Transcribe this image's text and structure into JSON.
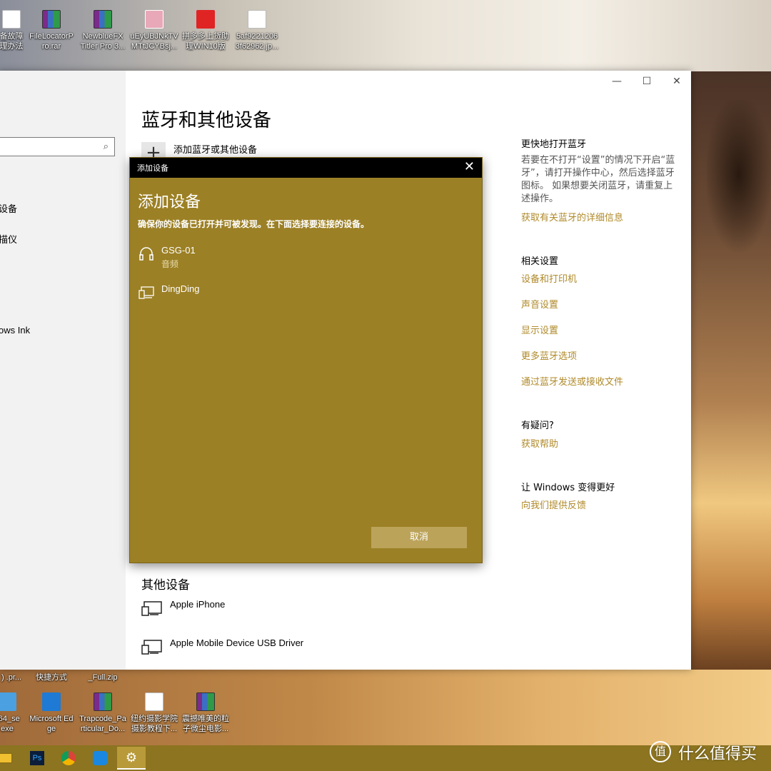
{
  "desktop": {
    "top_icons": [
      {
        "label_1": "备故障",
        "label_2": "理办法",
        "icon": "document-icon"
      },
      {
        "label_1": "FileLocatorP",
        "label_2": "ro.rar",
        "icon": "rar-archive-icon"
      },
      {
        "label_1": "NewblueFX",
        "label_2": "Titler Pro 3...",
        "icon": "rar-archive-icon"
      },
      {
        "label_1": "uEyUBJNkTV",
        "label_2": "MTtJCYBsj...",
        "icon": "image-icon"
      },
      {
        "label_1": "拼多多上货助",
        "label_2": "理WIN10版",
        "icon": "app-icon"
      },
      {
        "label_1": "5af9221206",
        "label_2": "3f62962.jp...",
        "icon": "document-icon"
      }
    ],
    "partial_labels": [
      {
        "label_1": ") .pr...",
        "label_2": ""
      },
      {
        "label_1": "快捷方式",
        "label_2": ""
      },
      {
        "label_1": "_Full.zip",
        "label_2": ""
      }
    ],
    "bottom_icons": [
      {
        "label_1": "x64_se",
        "label_2": "exe",
        "icon": "installer-icon"
      },
      {
        "label_1": "Microsoft Ed",
        "label_2": "ge",
        "icon": "edge-icon"
      },
      {
        "label_1": "Trapcode_Pa",
        "label_2": "rticular_Do...",
        "icon": "rar-archive-icon"
      },
      {
        "label_1": "纽约摄影学院",
        "label_2": "摄影教程下...",
        "icon": "document-icon"
      },
      {
        "label_1": "震撼唯美的粒",
        "label_2": "子微尘电影...",
        "icon": "rar-archive-icon"
      }
    ]
  },
  "settings": {
    "sidebar": {
      "items": [
        "设备",
        "描仪",
        "ows Ink"
      ]
    },
    "window_controls": {
      "minimize": "—",
      "maximize": "☐",
      "close": "✕"
    },
    "page_title": "蓝牙和其他设备",
    "add_device_label": "添加蓝牙或其他设备",
    "add_plus": "+",
    "right": {
      "quick_head": "更快地打开蓝牙",
      "quick_text": "若要在不打开“设置”的情况下开启“蓝牙”，请打开操作中心，然后选择蓝牙图标。 如果想要关闭蓝牙，请重复上述操作。",
      "quick_link": "获取有关蓝牙的详细信息",
      "related_head": "相关设置",
      "related_links": [
        "设备和打印机",
        "声音设置",
        "显示设置",
        "更多蓝牙选项",
        "通过蓝牙发送或接收文件"
      ],
      "help_head": "有疑问?",
      "help_link": "获取帮助",
      "better_head": "让 Windows 变得更好",
      "better_link": "向我们提供反馈"
    },
    "other_devices": {
      "title": "其他设备",
      "items": [
        "Apple iPhone",
        "Apple Mobile Device USB Driver"
      ]
    },
    "accent_color": "#b08a2a"
  },
  "dialog": {
    "bar_title": "添加设备",
    "close": "✕",
    "heading": "添加设备",
    "subtitle": "确保你的设备已打开并可被发现。在下面选择要连接的设备。",
    "devices": [
      {
        "name": "GSG-01",
        "type": "音频",
        "icon": "headphones-icon"
      },
      {
        "name": "DingDing",
        "type": "",
        "icon": "display-device-icon"
      }
    ],
    "cancel_label": "取消",
    "background_color": "#9c8025"
  },
  "taskbar": {
    "buttons": [
      "file-explorer-icon",
      "photoshop-icon",
      "chrome-icon",
      "uplay-icon",
      "settings-gear-icon"
    ],
    "ps_label": "Ps",
    "settings_glyph": "⚙"
  },
  "watermark": {
    "badge": "值",
    "text": "什么值得买"
  }
}
